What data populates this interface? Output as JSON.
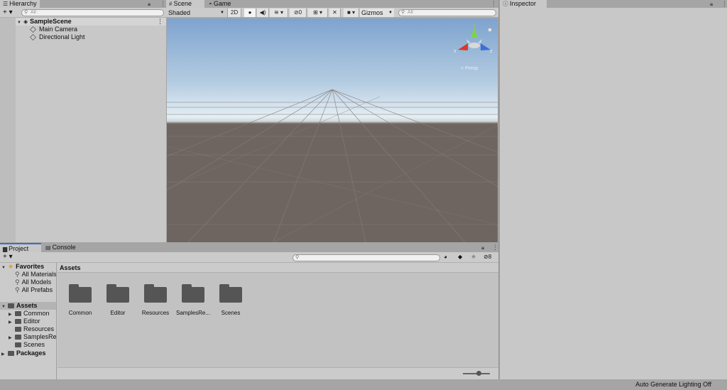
{
  "hierarchy": {
    "tab_label": "Hierarchy",
    "add_label": "+ ▾",
    "search_placeholder": "All",
    "scene_name": "SampleScene",
    "items": [
      {
        "label": "Main Camera"
      },
      {
        "label": "Directional Light"
      }
    ]
  },
  "scene": {
    "tabs": [
      {
        "label": "Scene"
      },
      {
        "label": "Game"
      }
    ],
    "shading_mode": "Shaded",
    "toggle_2d": "2D",
    "hidden_count": "0",
    "gizmos_label": "Gizmos",
    "search_placeholder": "All",
    "view_mode_label": "< Persp",
    "axis_labels": {
      "y": "y",
      "x": "x",
      "z": "z"
    },
    "colors": {
      "sky_top": "#7ea3cf",
      "horizon": "#e4eef5",
      "ground": "#6f6560",
      "grid": "#867e79",
      "axis_x": "#d33b2c",
      "axis_y": "#7fd34a",
      "axis_z": "#3b6fd8"
    }
  },
  "inspector": {
    "tab_label": "Inspector"
  },
  "project": {
    "tabs": [
      {
        "label": "Project"
      },
      {
        "label": "Console"
      }
    ],
    "add_label": "+ ▾",
    "hidden_count": "8",
    "sidebar": {
      "favorites_label": "Favorites",
      "favorites": [
        {
          "label": "All Materials"
        },
        {
          "label": "All Models"
        },
        {
          "label": "All Prefabs"
        }
      ],
      "assets_label": "Assets",
      "assets": [
        {
          "label": "Common"
        },
        {
          "label": "Editor"
        },
        {
          "label": "Resources"
        },
        {
          "label": "SamplesResources"
        },
        {
          "label": "Scenes"
        }
      ],
      "packages_label": "Packages"
    },
    "breadcrumb": "Assets",
    "folders": [
      {
        "label": "Common"
      },
      {
        "label": "Editor"
      },
      {
        "label": "Resources"
      },
      {
        "label": "SamplesRe..."
      },
      {
        "label": "Scenes"
      }
    ]
  },
  "status_bar": {
    "text": "Auto Generate Lighting Off"
  }
}
